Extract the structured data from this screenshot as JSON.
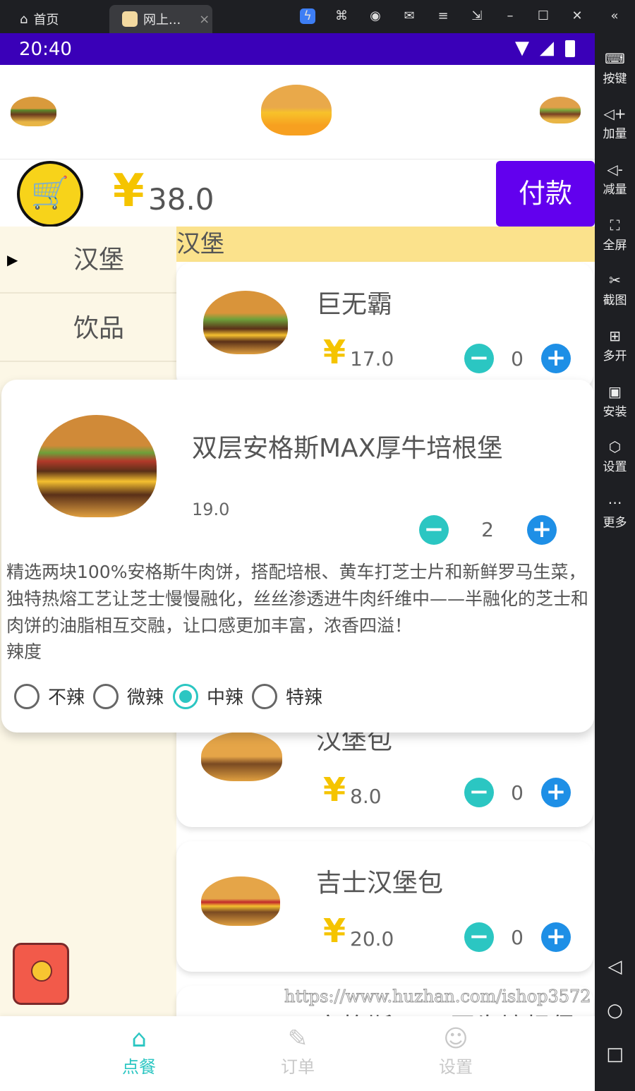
{
  "titlebar": {
    "home_tab": "首页",
    "app_tab": "网上...",
    "close": "×"
  },
  "status": {
    "time": "20:40"
  },
  "side": {
    "items": [
      {
        "label": "按键",
        "icon": "keyboard-icon"
      },
      {
        "label": "加量",
        "icon": "volume-up-icon"
      },
      {
        "label": "减量",
        "icon": "volume-down-icon"
      },
      {
        "label": "全屏",
        "icon": "fullscreen-icon"
      },
      {
        "label": "截图",
        "icon": "scissors-icon"
      },
      {
        "label": "多开",
        "icon": "multi-open-icon"
      },
      {
        "label": "安装",
        "icon": "apk-icon"
      },
      {
        "label": "设置",
        "icon": "settings-icon"
      },
      {
        "label": "更多",
        "icon": "more-icon"
      }
    ]
  },
  "cart": {
    "currency": "¥",
    "total": "38.0",
    "pay_label": "付款"
  },
  "categories": [
    {
      "label": "汉堡",
      "selected": true
    },
    {
      "label": "饮品",
      "selected": false
    }
  ],
  "category_header": "汉堡",
  "items": [
    {
      "name": "巨无霸",
      "currency": "¥",
      "price": "17.0",
      "qty": "0"
    },
    {
      "name": "汉堡包",
      "currency": "¥",
      "price": "8.0",
      "qty": "0"
    },
    {
      "name": "吉士汉堡包",
      "currency": "¥",
      "price": "20.0",
      "qty": "0"
    },
    {
      "name": "安格斯MAX厚牛培根堡"
    }
  ],
  "popup": {
    "name": "双层安格斯MAX厚牛培根堡",
    "price": "19.0",
    "qty": "2",
    "description": "精选两块100%安格斯牛肉饼，搭配培根、黄车打芝士片和新鲜罗马生菜，独特热熔工艺让芝士慢慢融化，丝丝渗透进牛肉纤维中——半融化的芝士和肉饼的油脂相互交融，让口感更加丰富，浓香四溢！",
    "spice_label": "辣度",
    "spice_options": [
      "不辣",
      "微辣",
      "中辣",
      "特辣"
    ],
    "spice_selected": "中辣"
  },
  "nav": {
    "items": [
      {
        "label": "点餐",
        "active": true
      },
      {
        "label": "订单",
        "active": false
      },
      {
        "label": "设置",
        "active": false
      }
    ]
  },
  "watermark": "https://www.huzhan.com/ishop3572",
  "colors": {
    "accent": "#2bc6c2",
    "plus": "#1e8fe6",
    "pay": "#6200ee",
    "status": "#3a00b8",
    "yen": "#f5c400"
  }
}
